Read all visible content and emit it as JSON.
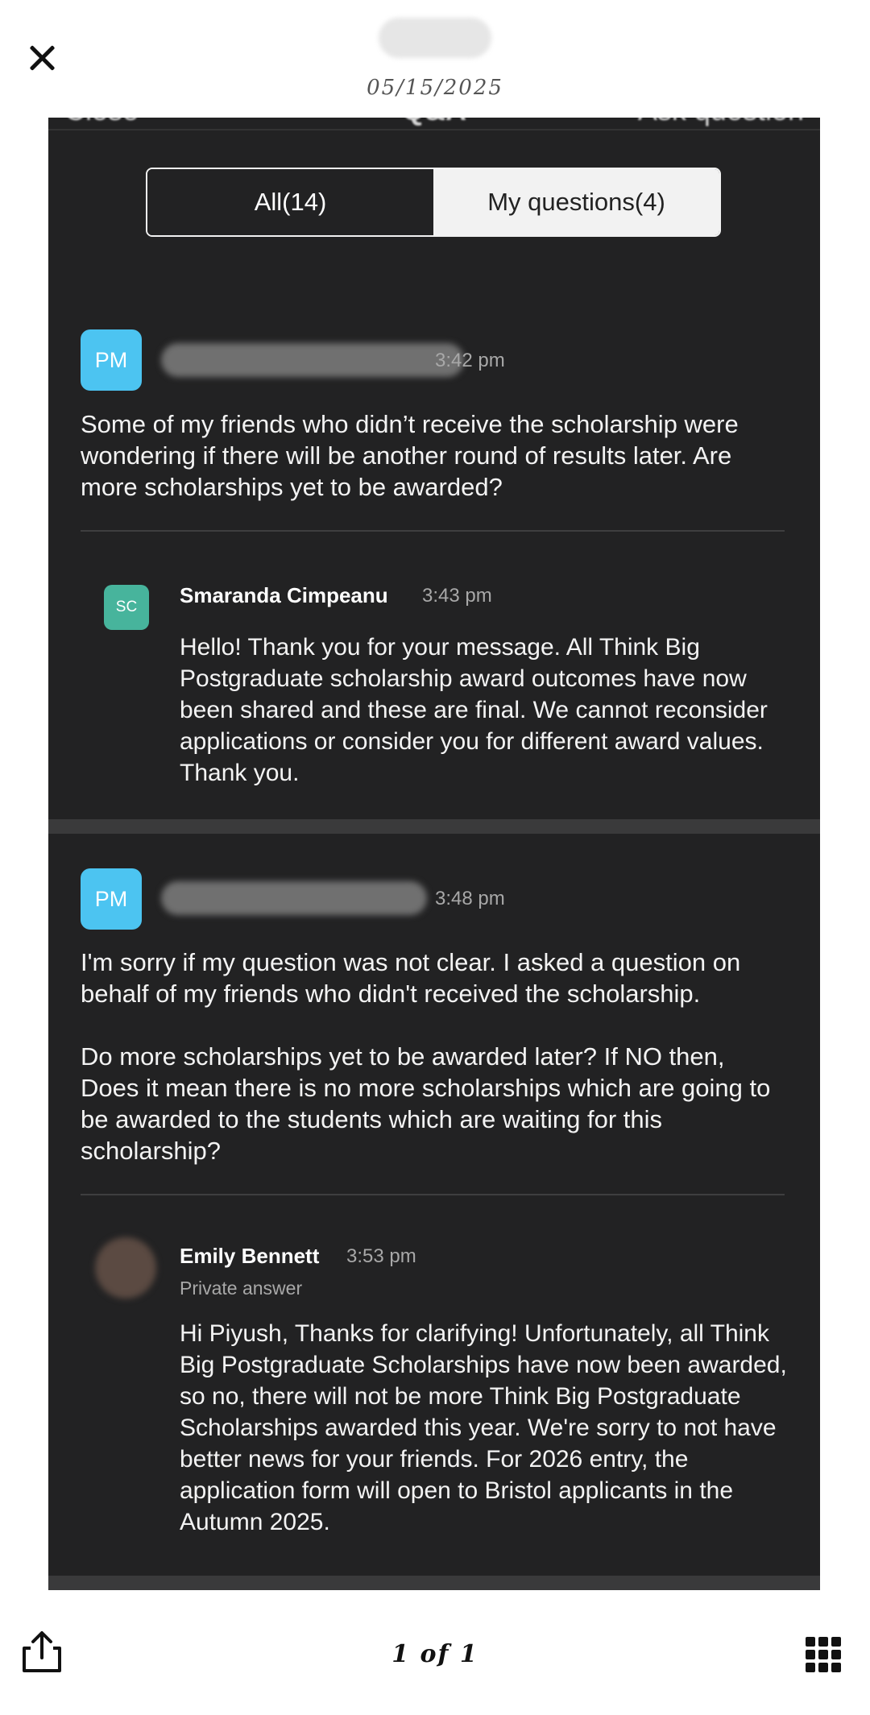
{
  "viewer": {
    "date": "05/15/2025",
    "page_indicator": "1 of 1"
  },
  "screen": {
    "header": {
      "left": "Close",
      "title": "Q&A",
      "right": "Ask question"
    },
    "tabs": {
      "all": "All(14)",
      "mine": "My questions(4)"
    },
    "threads": [
      {
        "avatar": "PM",
        "time": "3:42 pm",
        "question": "Some of my friends who didn’t receive the scholarship were wondering if there will be another round of results later. Are more scholarships yet to be awarded?",
        "answer": {
          "avatar": "SC",
          "name": "Smaranda Cimpeanu",
          "time": "3:43 pm",
          "text": "Hello! Thank you for your message. All Think Big Postgraduate scholarship award outcomes have now been shared and these are final. We cannot reconsider applications or consider you for different award values. Thank you."
        }
      },
      {
        "avatar": "PM",
        "time": "3:48 pm",
        "question_lines": [
          "I'm sorry if my question was not clear. I asked a question on behalf of my friends who didn't received the scholarship.",
          "Do more scholarships yet to be awarded later? If NO then, Does it mean there is no more scholarships which are going to be awarded to the students which are waiting for this scholarship?"
        ],
        "answer": {
          "name": "Emily Bennett",
          "time": "3:53 pm",
          "note": "Private answer",
          "text": "Hi Piyush, Thanks for clarifying!  Unfortunately, all Think Big Postgraduate Scholarships have now been awarded, so no, there will not be more Think Big Postgraduate Scholarships awarded this year. We're sorry to not have better news for your friends. For 2026 entry, the application form will open to Bristol applicants in the Autumn 2025."
        }
      }
    ]
  },
  "colors": {
    "background": "#222223",
    "avatar_blue": "#4cc4f1",
    "avatar_teal": "#47b49c"
  },
  "icons": [
    "close-icon",
    "share-icon",
    "grid-icon"
  ]
}
